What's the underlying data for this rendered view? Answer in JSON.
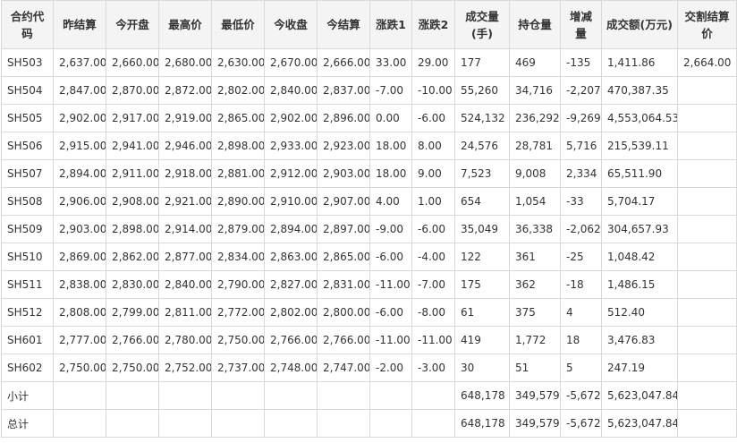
{
  "table": {
    "columns": [
      "合约代码",
      "昨结算",
      "今开盘",
      "最高价",
      "最低价",
      "今收盘",
      "今结算",
      "涨跌1",
      "涨跌2",
      "成交量(手)",
      "持仓量",
      "增减量",
      "成交额(万元)",
      "交割结算价"
    ],
    "rows": [
      [
        "SH503",
        "2,637.00",
        "2,660.00",
        "2,680.00",
        "2,630.00",
        "2,670.00",
        "2,666.00",
        "33.00",
        "29.00",
        "177",
        "469",
        "-135",
        "1,411.86",
        "2,664.00"
      ],
      [
        "SH504",
        "2,847.00",
        "2,870.00",
        "2,872.00",
        "2,802.00",
        "2,840.00",
        "2,837.00",
        "-7.00",
        "-10.00",
        "55,260",
        "34,716",
        "-2,207",
        "470,387.35",
        ""
      ],
      [
        "SH505",
        "2,902.00",
        "2,917.00",
        "2,919.00",
        "2,865.00",
        "2,902.00",
        "2,896.00",
        "0.00",
        "-6.00",
        "524,132",
        "236,292",
        "-9,269",
        "4,553,064.53",
        ""
      ],
      [
        "SH506",
        "2,915.00",
        "2,941.00",
        "2,946.00",
        "2,898.00",
        "2,933.00",
        "2,923.00",
        "18.00",
        "8.00",
        "24,576",
        "28,781",
        "5,716",
        "215,539.11",
        ""
      ],
      [
        "SH507",
        "2,894.00",
        "2,911.00",
        "2,918.00",
        "2,881.00",
        "2,912.00",
        "2,903.00",
        "18.00",
        "9.00",
        "7,523",
        "9,008",
        "2,334",
        "65,511.90",
        ""
      ],
      [
        "SH508",
        "2,906.00",
        "2,908.00",
        "2,921.00",
        "2,890.00",
        "2,910.00",
        "2,907.00",
        "4.00",
        "1.00",
        "654",
        "1,054",
        "-33",
        "5,704.17",
        ""
      ],
      [
        "SH509",
        "2,903.00",
        "2,898.00",
        "2,914.00",
        "2,879.00",
        "2,894.00",
        "2,897.00",
        "-9.00",
        "-6.00",
        "35,049",
        "36,338",
        "-2,062",
        "304,657.93",
        ""
      ],
      [
        "SH510",
        "2,869.00",
        "2,862.00",
        "2,877.00",
        "2,834.00",
        "2,863.00",
        "2,865.00",
        "-6.00",
        "-4.00",
        "122",
        "361",
        "-25",
        "1,048.42",
        ""
      ],
      [
        "SH511",
        "2,838.00",
        "2,830.00",
        "2,840.00",
        "2,790.00",
        "2,827.00",
        "2,831.00",
        "-11.00",
        "-7.00",
        "175",
        "362",
        "-18",
        "1,486.15",
        ""
      ],
      [
        "SH512",
        "2,808.00",
        "2,799.00",
        "2,811.00",
        "2,772.00",
        "2,802.00",
        "2,800.00",
        "-6.00",
        "-8.00",
        "61",
        "375",
        "4",
        "512.40",
        ""
      ],
      [
        "SH601",
        "2,777.00",
        "2,766.00",
        "2,780.00",
        "2,750.00",
        "2,766.00",
        "2,766.00",
        "-11.00",
        "-11.00",
        "419",
        "1,772",
        "18",
        "3,476.83",
        ""
      ],
      [
        "SH602",
        "2,750.00",
        "2,750.00",
        "2,752.00",
        "2,737.00",
        "2,748.00",
        "2,747.00",
        "-2.00",
        "-3.00",
        "30",
        "51",
        "5",
        "247.19",
        ""
      ],
      [
        "小计",
        "",
        "",
        "",
        "",
        "",
        "",
        "",
        "",
        "648,178",
        "349,579",
        "-5,672",
        "5,623,047.84",
        ""
      ],
      [
        "总计",
        "",
        "",
        "",
        "",
        "",
        "",
        "",
        "",
        "648,178",
        "349,579",
        "-5,672",
        "5,623,047.84",
        ""
      ]
    ]
  }
}
